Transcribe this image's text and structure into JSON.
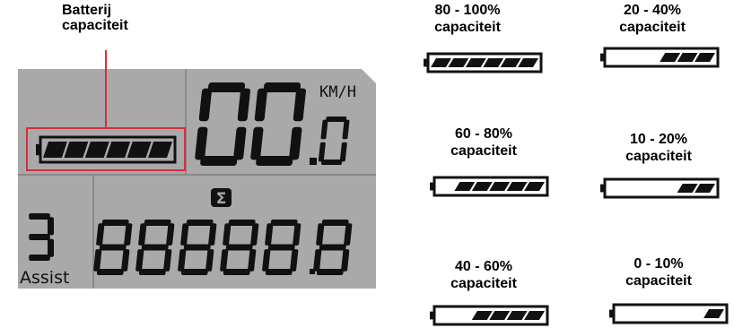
{
  "callout": {
    "line1": "Batterij",
    "line2": "capaciteit"
  },
  "display": {
    "speed_unit": "KM/H",
    "speed_value": "00",
    "speed_decimal": "0",
    "assist_level": "3",
    "assist_label": "Assist",
    "odometer": "88888",
    "odometer_decimal": "8",
    "sigma_symbol": "Σ",
    "battery_segments_on": 6
  },
  "levels": [
    {
      "range": "80 - 100%",
      "label": "capaciteit",
      "segments_on": 6
    },
    {
      "range": "20 - 40%",
      "label": "capaciteit",
      "segments_on": 3
    },
    {
      "range": "60 - 80%",
      "label": "capaciteit",
      "segments_on": 5
    },
    {
      "range": "10 - 20%",
      "label": "capaciteit",
      "segments_on": 2
    },
    {
      "range": "40 - 60%",
      "label": "capaciteit",
      "segments_on": 4
    },
    {
      "range": "0 - 10%",
      "label": "capaciteit",
      "segments_on": 1
    }
  ],
  "colors": {
    "lcd_bg": "#a9a9a9",
    "lcd_line": "#8a8a8a",
    "segment": "#111111",
    "highlight": "#d32f3c"
  }
}
